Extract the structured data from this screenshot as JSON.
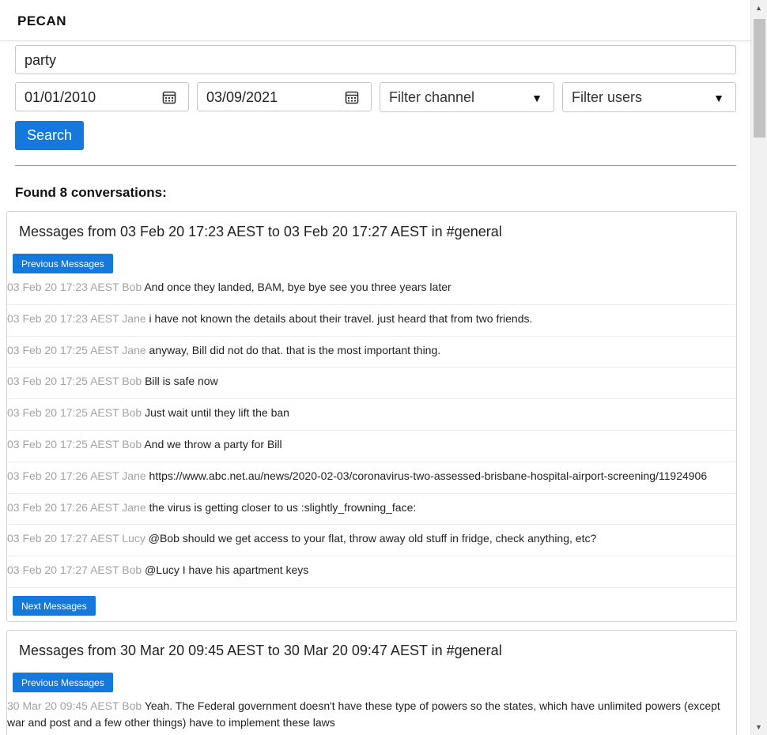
{
  "app": {
    "title": "PECAN"
  },
  "search": {
    "query": "party",
    "date_from": "01/01/2010",
    "date_to": "03/09/2021",
    "channel_placeholder": "Filter channel",
    "users_placeholder": "Filter users",
    "button_label": "Search"
  },
  "results": {
    "summary": "Found 8 conversations:",
    "conversations": [
      {
        "title": "Messages from 03 Feb 20 17:23 AEST to 03 Feb 20 17:27 AEST in #general",
        "prev_label": "Previous Messages",
        "next_label": "Next Messages",
        "messages": [
          {
            "meta": "03 Feb 20 17:23 AEST Bob",
            "text": "And once they landed, BAM, bye bye see you three years later"
          },
          {
            "meta": "03 Feb 20 17:23 AEST Jane",
            "text": "i have not known the details about their travel. just heard that from two friends."
          },
          {
            "meta": "03 Feb 20 17:25 AEST Jane",
            "text": "anyway, Bill did not do that. that is the most important thing."
          },
          {
            "meta": "03 Feb 20 17:25 AEST Bob",
            "text": "Bill is safe now"
          },
          {
            "meta": "03 Feb 20 17:25 AEST Bob",
            "text": "Just wait until they lift the ban"
          },
          {
            "meta": "03 Feb 20 17:25 AEST Bob",
            "text": "And we throw a party for Bill"
          },
          {
            "meta": "03 Feb 20 17:26 AEST Jane",
            "text": "https://www.abc.net.au/news/2020-02-03/coronavirus-two-assessed-brisbane-hospital-airport-screening/11924906"
          },
          {
            "meta": "03 Feb 20 17:26 AEST Jane",
            "text": "the virus is getting closer to us :slightly_frowning_face:"
          },
          {
            "meta": "03 Feb 20 17:27 AEST Lucy",
            "text": "@Bob should we get access to your flat, throw away old stuff in fridge, check anything, etc?"
          },
          {
            "meta": "03 Feb 20 17:27 AEST Bob",
            "text": "@Lucy I have his apartment keys"
          }
        ]
      },
      {
        "title": "Messages from 30 Mar 20 09:45 AEST to 30 Mar 20 09:47 AEST in #general",
        "prev_label": "Previous Messages",
        "messages": [
          {
            "meta": "30 Mar 20 09:45 AEST Bob",
            "text": "Yeah. The Federal government doesn't have these type of powers so the states, which have unlimited powers (except war and post and a few other things) have to implement these laws"
          }
        ]
      }
    ]
  },
  "icons": {
    "calendar": "calendar-icon",
    "dropdown": "caret-down-icon"
  },
  "colors": {
    "primary": "#1479db",
    "meta_text": "#a3a3a3"
  }
}
